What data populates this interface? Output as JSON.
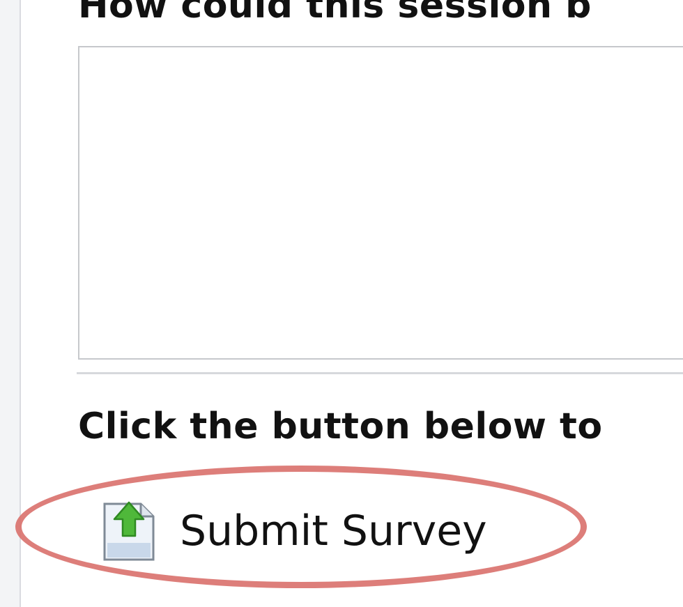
{
  "survey": {
    "question_heading": "How could this session b",
    "feedback_value": "",
    "instruction": "Click the button below to",
    "submit_label": "Submit Survey",
    "submit_icon": "upload-document-icon"
  },
  "colors": {
    "highlight": "#d9706b",
    "icon_arrow": "#4fb83a",
    "icon_page": "#c9d8ea"
  }
}
